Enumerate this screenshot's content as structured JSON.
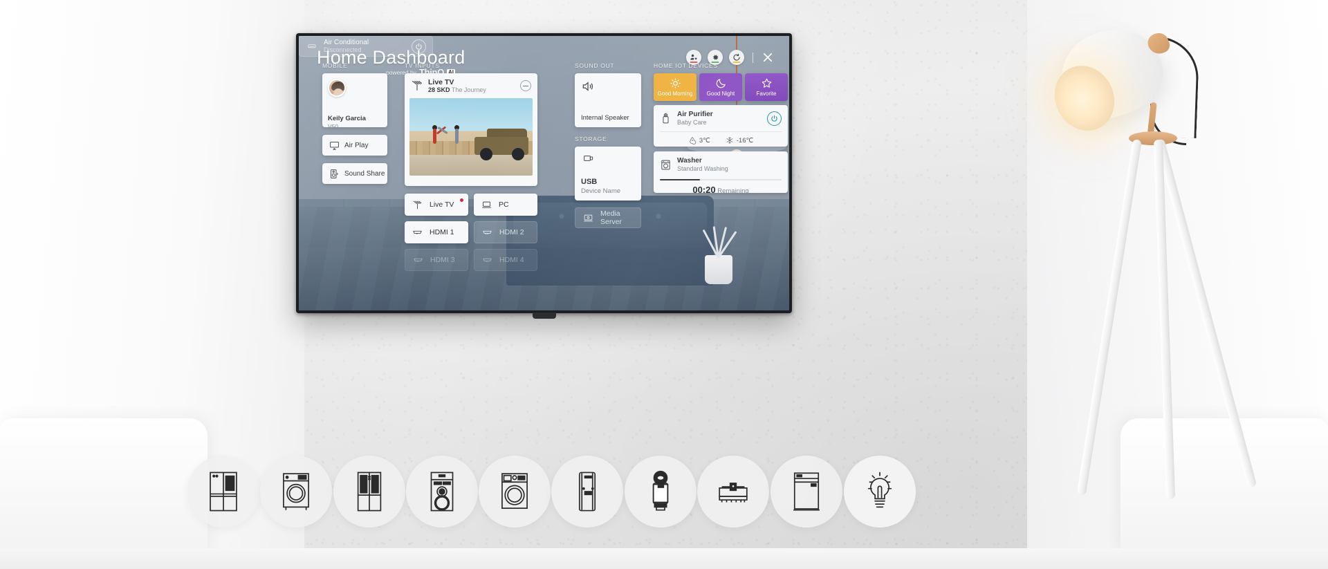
{
  "header": {
    "title": "Home Dashboard",
    "powered_by": "powered by",
    "brand": "ThinQ",
    "brand_badge": "AI"
  },
  "top_icons": [
    {
      "name": "user-profile-icon",
      "underline_color": "#e2574c"
    },
    {
      "name": "settings-gear-icon",
      "underline_color": "#57b85e"
    },
    {
      "name": "refresh-icon",
      "underline_color": "#e8c23a"
    }
  ],
  "close_label": "Close",
  "sections": {
    "mobile": "MOBILE",
    "tv_inputs": "TV INPUTS",
    "sound_out": "SOUND OUT",
    "storage": "STORAGE",
    "home_iot": "HOME IOT DEVICES"
  },
  "mobile": {
    "user_name": "Keily Garcia",
    "device_model": "V50",
    "air_play": "Air Play",
    "sound_share": "Sound Share"
  },
  "tv_inputs": {
    "current": {
      "title": "Live TV",
      "channel": "28 SKD",
      "program": "The Journey"
    },
    "tiles": [
      {
        "label": "Live TV",
        "icon": "antenna-icon",
        "state": "active",
        "badge": true
      },
      {
        "label": "PC",
        "icon": "laptop-icon",
        "state": "active",
        "badge": false
      },
      {
        "label": "HDMI 1",
        "icon": "hdmi-icon",
        "state": "active",
        "badge": false
      },
      {
        "label": "HDMI 2",
        "icon": "hdmi-icon",
        "state": "ghost",
        "badge": false
      },
      {
        "label": "HDMI 3",
        "icon": "hdmi-icon",
        "state": "faded",
        "badge": false
      },
      {
        "label": "HDMI 4",
        "icon": "hdmi-icon",
        "state": "faded",
        "badge": false
      }
    ]
  },
  "sound_out": {
    "device": "Internal Speaker"
  },
  "storage": {
    "usb_title": "USB",
    "usb_subtitle": "Device Name",
    "media_server": "Media Server"
  },
  "home_iot": {
    "scenes": [
      {
        "label": "Good Morning",
        "icon": "sun-icon",
        "color": "#eeb13c"
      },
      {
        "label": "Good Night",
        "icon": "moon-icon",
        "color": "#447de8"
      },
      {
        "label": "Favorite",
        "icon": "star-icon",
        "color": "#8a4ec2"
      }
    ],
    "air_purifier": {
      "name": "Air Purifier",
      "mode": "Baby Care",
      "power_state": "on",
      "stat_humidity": "3℃",
      "stat_temperature": "-16℃"
    },
    "washer": {
      "name": "Washer",
      "mode": "Standard Washing",
      "progress_percent": 33,
      "time_value": "00:20",
      "time_label": "Remaining"
    },
    "air_conditioner": {
      "name": "Air Conditional",
      "status": "Disconnected",
      "power_state": "off"
    }
  },
  "appliance_icons": [
    {
      "name": "refrigerator-icon"
    },
    {
      "name": "washing-machine-icon"
    },
    {
      "name": "styler-closet-icon"
    },
    {
      "name": "audio-tower-icon"
    },
    {
      "name": "washer-dryer-icon"
    },
    {
      "name": "air-conditioner-tower-icon"
    },
    {
      "name": "air-purifier-icon"
    },
    {
      "name": "robot-vacuum-icon"
    },
    {
      "name": "dishwasher-icon"
    },
    {
      "name": "light-bulb-icon"
    }
  ]
}
